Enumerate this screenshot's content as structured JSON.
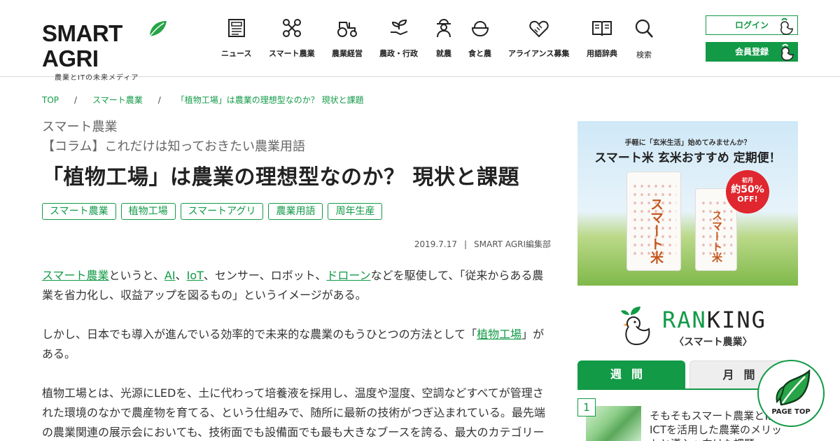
{
  "header": {
    "logo_text": "SMART AGRI",
    "logo_tagline": "農業とITの未来メディア",
    "nav": [
      {
        "label": "ニュース",
        "icon": "newspaper-icon"
      },
      {
        "label": "スマート農業",
        "icon": "drone-icon"
      },
      {
        "label": "農業経営",
        "icon": "tractor-icon"
      },
      {
        "label": "農政・行政",
        "icon": "sprout-hand-icon"
      },
      {
        "label": "就農",
        "icon": "farmer-icon"
      },
      {
        "label": "食と農",
        "icon": "rice-bowl-icon"
      },
      {
        "label": "アライアンス募集",
        "icon": "handshake-icon"
      },
      {
        "label": "用語辞典",
        "icon": "book-icon"
      },
      {
        "label": "検索",
        "icon": "search-icon"
      }
    ],
    "login_label": "ログイン",
    "member_label": "会員登録"
  },
  "breadcrumb": [
    "TOP",
    "スマート農業",
    "「植物工場」は農業の理想型なのか？ 現状と課題"
  ],
  "article": {
    "category": "スマート農業",
    "series": "【コラム】これだけは知っておきたい農業用語",
    "title": "「植物工場」は農業の理想型なのか？ 現状と課題",
    "tags": [
      "スマート農業",
      "植物工場",
      "スマートアグリ",
      "農業用語",
      "周年生産"
    ],
    "date": "2019.7.17",
    "author": "SMART AGRI編集部",
    "p1": {
      "link1": "スマート農業",
      "t1": "というと、",
      "link2": "AI",
      "t2": "、",
      "link3": "IoT",
      "t3": "、センサー、ロボット、",
      "link4": "ドローン",
      "t4": "などを駆使して、「従来からある農業を省力化し、収益アップを図るもの」というイメージがある。"
    },
    "p2": {
      "t1": "しかし、日本でも導入が進んでいる効率的で未来的な農業のもうひとつの方法として「",
      "link1": "植物工場",
      "t2": "」がある。"
    },
    "p3": "植物工場とは、光源にLEDを、土に代わって培養液を採用し、温度や湿度、空調などすべてが管理された環境のなかで農産物を育てる、という仕組みで、随所に最新の技術がつぎ込まれている。最先端の農業関連の展示会においても、技術面でも設備面でも最も大きなブースを誇る、最大のカテゴリー"
  },
  "ad": {
    "small": "手軽に「玄米生活」始めてみませんか？",
    "big": "スマート米 玄米おすすめ 定期便！",
    "bag_text": "スマート米",
    "badge_small": "初月",
    "badge_pct": "約50%",
    "badge_off": "OFF!"
  },
  "ranking": {
    "title_green": "RAN",
    "title_black": "KING",
    "subtitle": "〈スマート農業〉",
    "tab_week": "週間",
    "tab_month": "月間",
    "items": [
      {
        "rank": "1",
        "title": "そもそもスマート農業とは？ ICTを活用した農業のメリットと導入へ向けた課題"
      }
    ]
  },
  "page_top_label": "PAGE TOP",
  "colors": {
    "accent": "#129a47",
    "badge": "#e0262e"
  }
}
